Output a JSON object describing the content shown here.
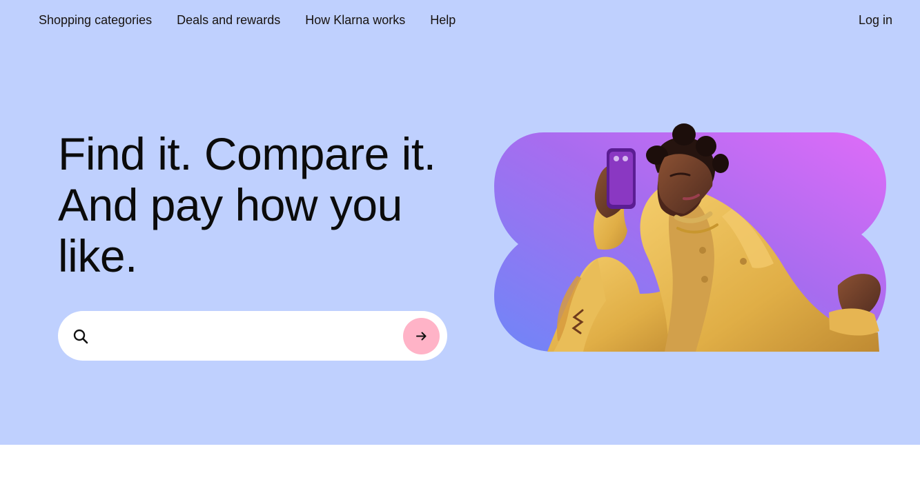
{
  "nav": {
    "items": [
      {
        "label": "Shopping categories"
      },
      {
        "label": "Deals and rewards"
      },
      {
        "label": "How Klarna works"
      },
      {
        "label": "Help"
      }
    ],
    "login_label": "Log in"
  },
  "hero": {
    "headline_line1": "Find it. Compare it.",
    "headline_line2": "And pay how you",
    "headline_line3": "like.",
    "search": {
      "value": "",
      "placeholder": ""
    }
  },
  "icons": {
    "search": "search-icon",
    "submit": "arrow-right-icon"
  },
  "colors": {
    "hero_background": "#bfd0fe",
    "submit_button": "#ffb3c7",
    "text": "#17120f",
    "visual_gradient_start": "#6f86f7",
    "visual_gradient_mid": "#a86cef",
    "visual_gradient_end": "#df6cf8",
    "outfit_yellow": "#e7bd58"
  }
}
